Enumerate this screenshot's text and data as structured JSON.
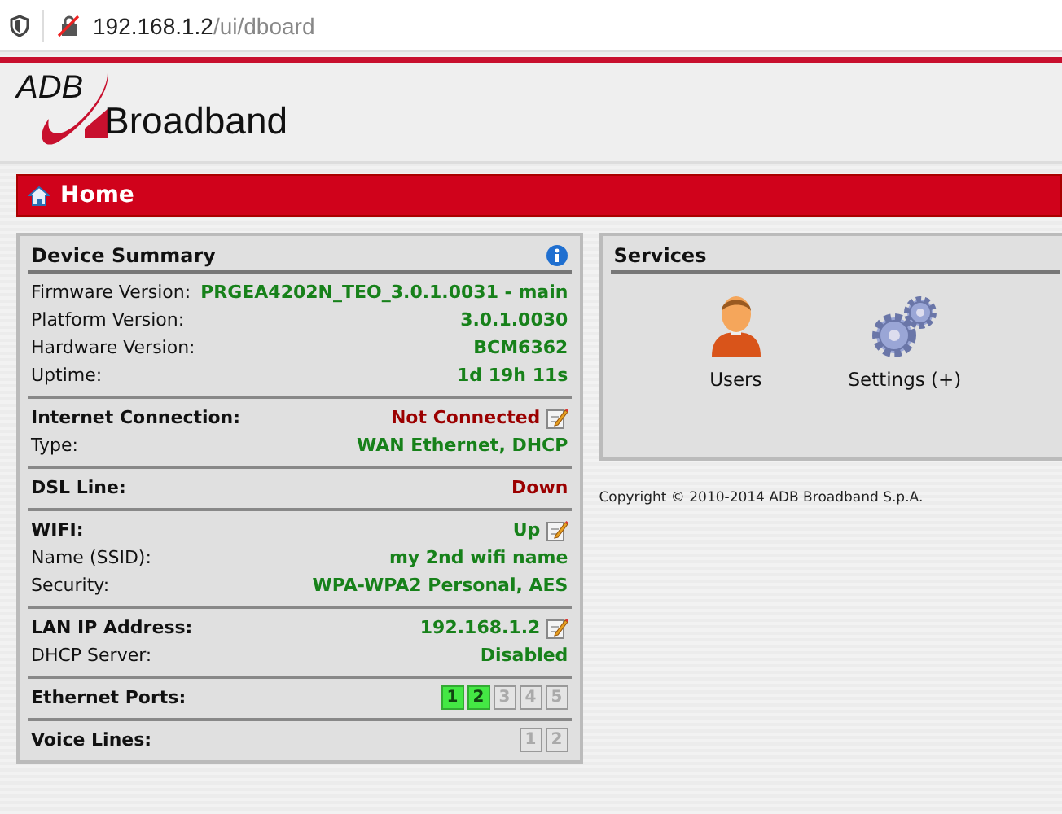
{
  "address_bar": {
    "host": "192.168.1.2",
    "path": "/ui/dboard"
  },
  "logo": {
    "mark": "ADB",
    "name": "Broadband"
  },
  "home_bar": {
    "title": "Home"
  },
  "device_summary": {
    "title": "Device Summary",
    "sections": [
      {
        "rows": [
          {
            "kind": "text",
            "label": "Firmware Version:",
            "heading": false,
            "value": "PRGEA4202N_TEO_3.0.1.0031 - main",
            "alert": false,
            "editable": false
          },
          {
            "kind": "text",
            "label": "Platform Version:",
            "heading": false,
            "value": "3.0.1.0030",
            "alert": false,
            "editable": false
          },
          {
            "kind": "text",
            "label": "Hardware Version:",
            "heading": false,
            "value": "BCM6362",
            "alert": false,
            "editable": false
          },
          {
            "kind": "text",
            "label": "Uptime:",
            "heading": false,
            "value": "1d 19h 11s",
            "alert": false,
            "editable": false
          }
        ]
      },
      {
        "rows": [
          {
            "kind": "text",
            "label": "Internet Connection:",
            "heading": true,
            "value": "Not Connected",
            "alert": true,
            "editable": true
          },
          {
            "kind": "text",
            "label": "Type:",
            "heading": false,
            "value": "WAN Ethernet, DHCP",
            "alert": false,
            "editable": false
          }
        ]
      },
      {
        "rows": [
          {
            "kind": "text",
            "label": "DSL Line:",
            "heading": true,
            "value": "Down",
            "alert": true,
            "editable": false
          }
        ]
      },
      {
        "rows": [
          {
            "kind": "text",
            "label": "WIFI:",
            "heading": true,
            "value": "Up",
            "alert": false,
            "editable": true
          },
          {
            "kind": "text",
            "label": "Name (SSID):",
            "heading": false,
            "value": "my 2nd wifi name",
            "alert": false,
            "editable": false
          },
          {
            "kind": "text",
            "label": "Security:",
            "heading": false,
            "value": "WPA-WPA2 Personal, AES",
            "alert": false,
            "editable": false
          }
        ]
      },
      {
        "rows": [
          {
            "kind": "text",
            "label": "LAN IP Address:",
            "heading": true,
            "value": "192.168.1.2",
            "alert": false,
            "editable": true
          },
          {
            "kind": "text",
            "label": "DHCP Server:",
            "heading": false,
            "value": "Disabled",
            "alert": false,
            "editable": false
          }
        ]
      },
      {
        "rows": [
          {
            "kind": "ports",
            "label": "Ethernet Ports:",
            "heading": true,
            "ports": [
              {
                "label": "1",
                "active": true
              },
              {
                "label": "2",
                "active": true
              },
              {
                "label": "3",
                "active": false
              },
              {
                "label": "4",
                "active": false
              },
              {
                "label": "5",
                "active": false
              }
            ]
          }
        ]
      },
      {
        "rows": [
          {
            "kind": "ports",
            "label": "Voice Lines:",
            "heading": true,
            "ports": [
              {
                "label": "1",
                "active": false
              },
              {
                "label": "2",
                "active": false
              }
            ]
          }
        ]
      }
    ]
  },
  "services": {
    "title": "Services",
    "items": [
      {
        "kind": "user",
        "label": "Users"
      },
      {
        "kind": "settings",
        "label": "Settings (+)"
      }
    ]
  },
  "copyright": "Copyright © 2010-2014 ADB Broadband S.p.A."
}
